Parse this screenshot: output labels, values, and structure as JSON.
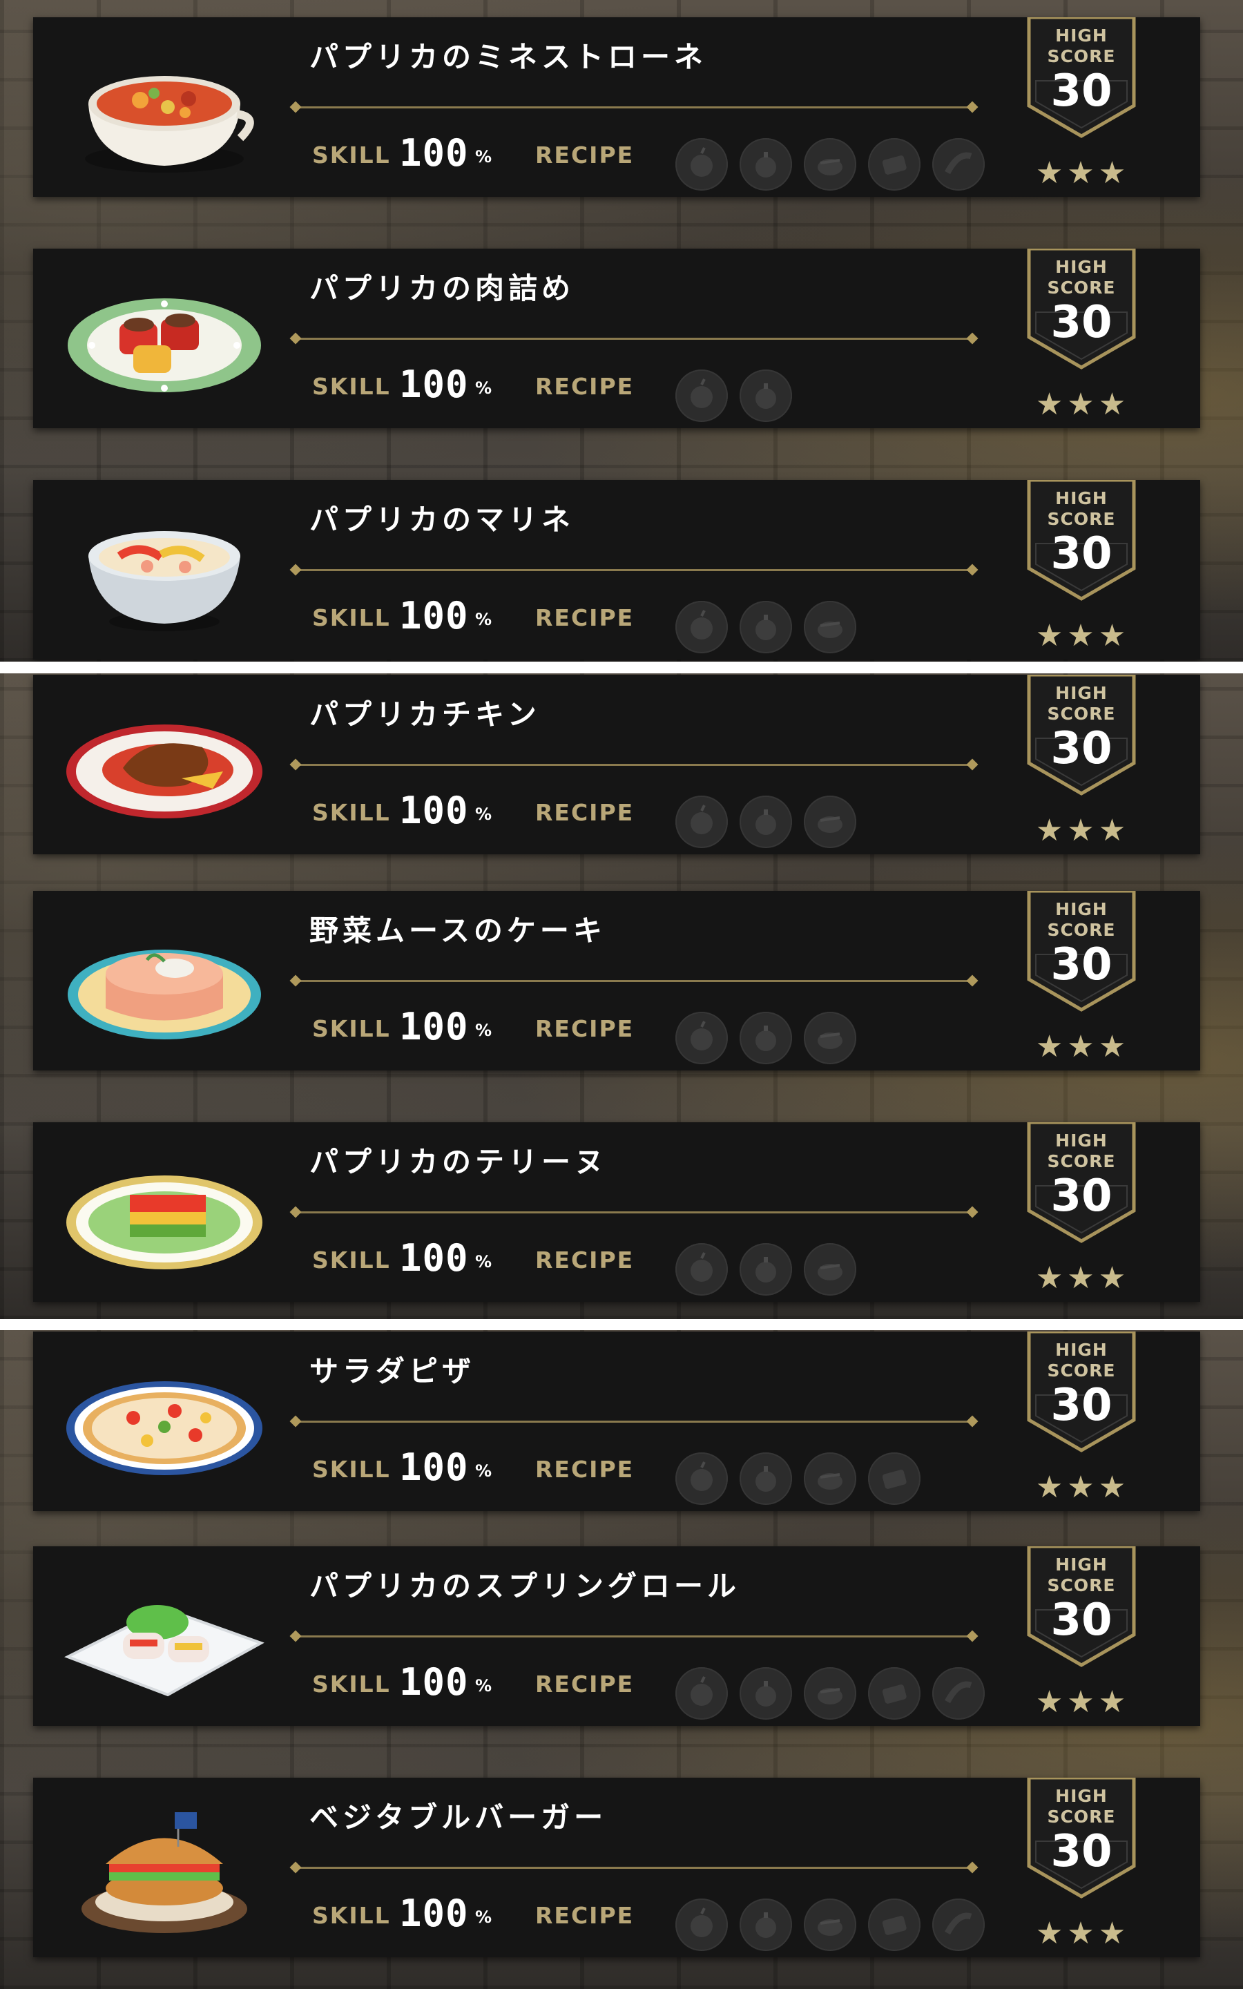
{
  "labels": {
    "skill": "SKILL",
    "unit": "%",
    "recipe": "RECIPE",
    "high": "HIGH",
    "score": "SCORE",
    "stars": "★★★"
  },
  "recipes": [
    {
      "name": "パプリカのミネストローネ",
      "skill": "100",
      "high_score": "30",
      "ingredient_count": 5,
      "dish_icon": "minestrone-bowl-icon"
    },
    {
      "name": "パプリカの肉詰め",
      "skill": "100",
      "high_score": "30",
      "ingredient_count": 2,
      "dish_icon": "stuffed-paprika-plate-icon"
    },
    {
      "name": "パプリカのマリネ",
      "skill": "100",
      "high_score": "30",
      "ingredient_count": 3,
      "dish_icon": "marinade-bowl-icon"
    },
    {
      "name": "パプリカチキン",
      "skill": "100",
      "high_score": "30",
      "ingredient_count": 3,
      "dish_icon": "paprika-chicken-plate-icon"
    },
    {
      "name": "野菜ムースのケーキ",
      "skill": "100",
      "high_score": "30",
      "ingredient_count": 3,
      "dish_icon": "vegetable-mousse-cake-icon"
    },
    {
      "name": "パプリカのテリーヌ",
      "skill": "100",
      "high_score": "30",
      "ingredient_count": 3,
      "dish_icon": "terrine-plate-icon"
    },
    {
      "name": "サラダピザ",
      "skill": "100",
      "high_score": "30",
      "ingredient_count": 4,
      "dish_icon": "salad-pizza-icon"
    },
    {
      "name": "パプリカのスプリングロール",
      "skill": "100",
      "high_score": "30",
      "ingredient_count": 5,
      "dish_icon": "spring-roll-plate-icon"
    },
    {
      "name": "ベジタブルバーガー",
      "skill": "100",
      "high_score": "30",
      "ingredient_count": 5,
      "dish_icon": "vegetable-burger-icon"
    }
  ]
}
